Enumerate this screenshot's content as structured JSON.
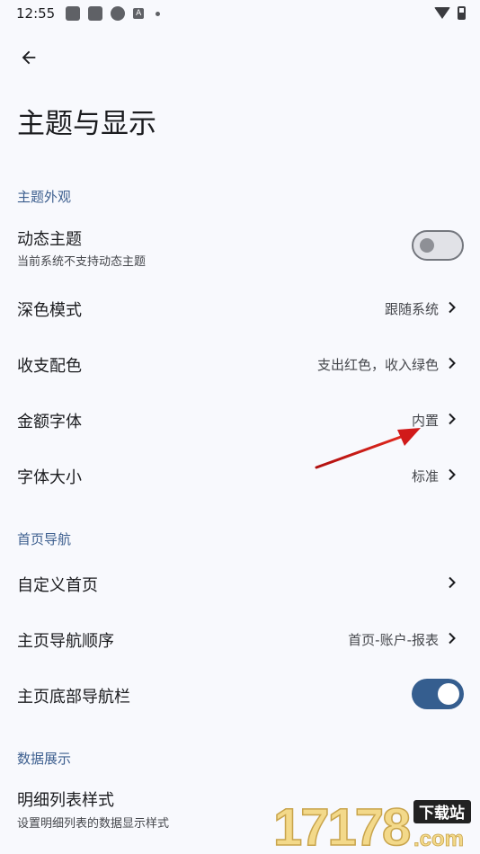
{
  "status_bar": {
    "time": "12:55",
    "notif_icon_text": "A"
  },
  "header": {
    "title": "主题与显示"
  },
  "sections": {
    "theme": {
      "header": "主题外观",
      "dynamic_theme": {
        "title": "动态主题",
        "subtitle": "当前系统不支持动态主题",
        "enabled": false
      },
      "dark_mode": {
        "title": "深色模式",
        "value": "跟随系统"
      },
      "income_color": {
        "title": "收支配色",
        "value": "支出红色，收入绿色"
      },
      "amount_font": {
        "title": "金额字体",
        "value": "内置"
      },
      "font_size": {
        "title": "字体大小",
        "value": "标准"
      }
    },
    "home_nav": {
      "header": "首页导航",
      "custom_home": {
        "title": "自定义首页"
      },
      "nav_order": {
        "title": "主页导航顺序",
        "value": "首页-账户-报表"
      },
      "bottom_nav": {
        "title": "主页底部导航栏",
        "enabled": true
      }
    },
    "data_display": {
      "header": "数据展示",
      "detail_list_style": {
        "title": "明细列表样式",
        "subtitle": "设置明细列表的数据显示样式"
      }
    }
  },
  "watermark": {
    "text": "17178",
    "badge": "下载站",
    "suffix": ".com"
  },
  "colors": {
    "accent": "#355e8f",
    "section_header": "#3d5f8f",
    "background": "#f8f9fd",
    "annotation_arrow": "#d11a1a"
  }
}
